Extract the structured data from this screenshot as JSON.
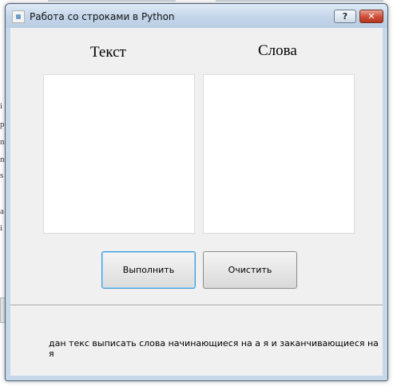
{
  "window": {
    "title": "Работа со строками в Python",
    "help_glyph": "?",
    "close_glyph": "✕"
  },
  "labels": {
    "text_heading": "Текст",
    "words_heading": "Слова"
  },
  "inputs": {
    "text_value": "",
    "words_value": ""
  },
  "buttons": {
    "run": "Выполнить",
    "clear": "Очистить"
  },
  "task_text": "дан текс выписать слова начинающиеся на а я и заканчивающиеся на я",
  "background": {
    "chars": [
      "i",
      "p",
      "n",
      "n",
      "s",
      "a",
      "i"
    ]
  }
}
